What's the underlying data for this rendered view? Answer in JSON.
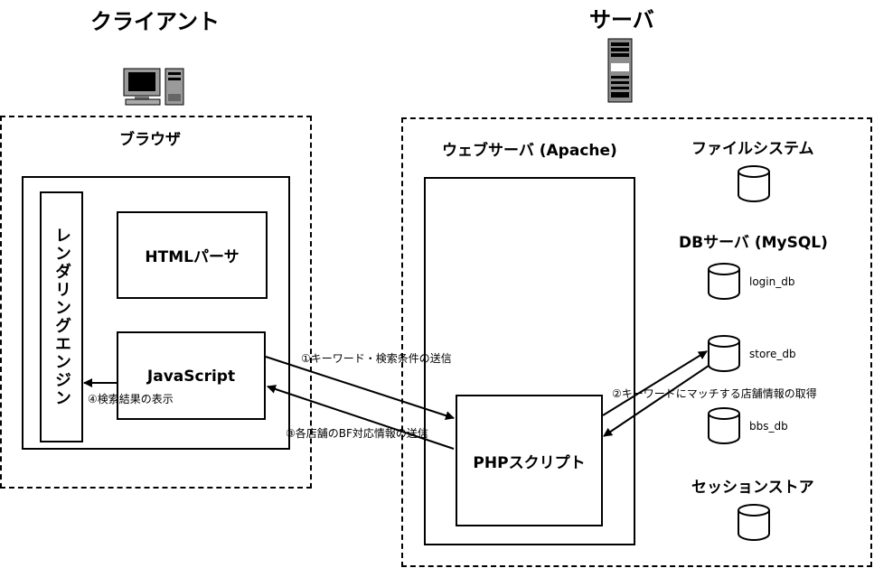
{
  "client": {
    "title": "クライアント",
    "browser_label": "ブラウザ",
    "rendering_engine": "レンダリングエンジン",
    "html_parser": "HTMLパーサ",
    "javascript": "JavaScript",
    "computer_icon": "desktop-computer-icon"
  },
  "server": {
    "title": "サーバ",
    "web_server": "ウェブサーバ (Apache)",
    "php_script": "PHPスクリプト",
    "filesystem": "ファイルシステム",
    "db_server": "DBサーバ (MySQL)",
    "session_store": "セッションストア",
    "databases": [
      "login_db",
      "store_db",
      "bbs_db"
    ],
    "server_icon": "server-rack-icon"
  },
  "arrows": {
    "step1": "①キーワード・検索条件の送信",
    "step2": "②キーワードにマッチする店舗情報の取得",
    "step3": "③各店舗のBF対応情報の送信",
    "step4": "④検索結果の表示"
  }
}
